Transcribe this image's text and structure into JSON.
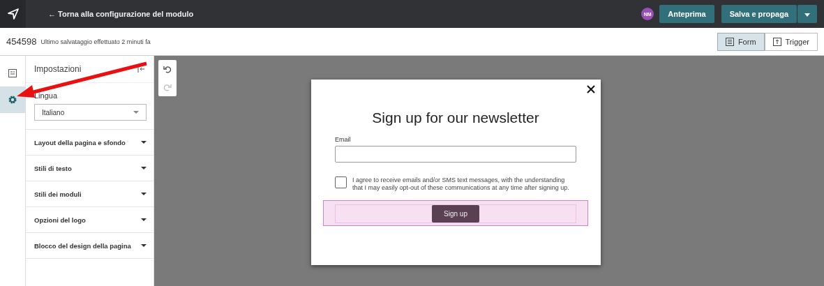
{
  "topbar": {
    "back_link": "← Torna alla configurazione del modulo",
    "avatar": "NM",
    "preview_button": "Anteprima",
    "save_button": "Salva e propaga"
  },
  "subbar": {
    "id": "454598",
    "saved_note": "Ultimo salvataggio effettuato 2 minuti fa",
    "views": [
      {
        "label": "Form",
        "kind": "form",
        "selected": true
      },
      {
        "label": "Trigger",
        "kind": "trigger",
        "selected": false
      }
    ]
  },
  "rail": [
    {
      "kind": "layout",
      "selected": false
    },
    {
      "kind": "settings",
      "selected": true
    }
  ],
  "settings": {
    "title": "Impostazioni",
    "language_label": "Lingua",
    "language_value": "Italiano",
    "sections": [
      "Layout della pagina e sfondo",
      "Stili di testo",
      "Stili dei moduli",
      "Opzioni del logo",
      "Blocco del design della pagina"
    ]
  },
  "popup": {
    "heading": "Sign up for our newsletter",
    "email_label": "Email",
    "consent": {
      "text": "I agree to receive emails and/or SMS text messages, with the understanding that I may easily opt-out of these communications at any time after signing up.",
      "checked": false
    },
    "submit": "Sign up"
  }
}
